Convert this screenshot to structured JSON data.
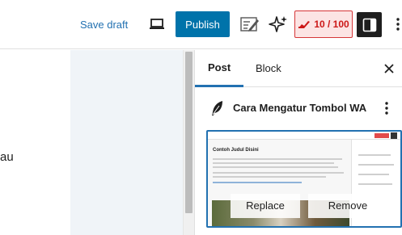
{
  "toolbar": {
    "save_draft": "Save draft",
    "publish": "Publish",
    "score": "10 / 100",
    "preview_icon": "laptop-icon",
    "edit_icon": "edit-note-icon",
    "ai_icon": "sparkles-icon",
    "settings_icon": "sidebar-toggle-icon",
    "more_icon": "more-vertical-icon"
  },
  "editor": {
    "partial_text": "au"
  },
  "sidebar": {
    "tabs": [
      {
        "label": "Post"
      },
      {
        "label": "Block"
      }
    ],
    "close_icon": "close-icon",
    "post": {
      "title": "Cara Mengatur Tombol WA",
      "type_icon": "feather-icon",
      "more_icon": "more-vertical-icon"
    },
    "featured_image": {
      "preview_heading": "Contoh Judul Disini",
      "replace": "Replace",
      "remove": "Remove"
    }
  },
  "colors": {
    "accent": "#0073aa",
    "score_red": "#cc1818",
    "score_bg": "#fce4e4",
    "tab_underline": "#2271b1"
  }
}
